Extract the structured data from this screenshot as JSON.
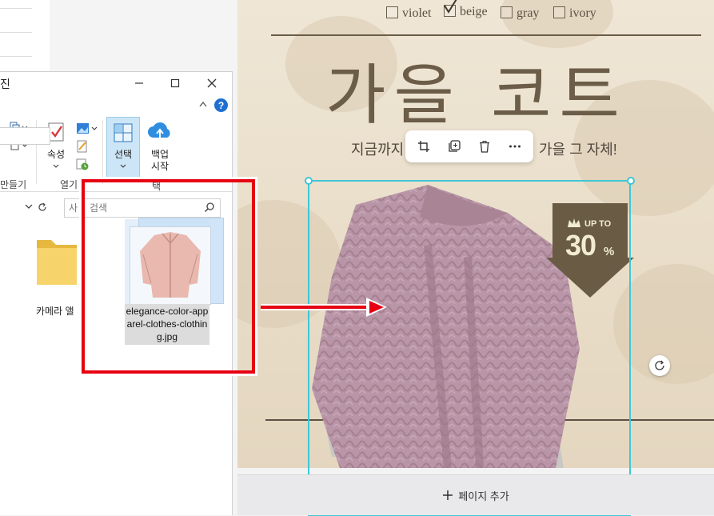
{
  "explorer": {
    "title_fragment": "진",
    "ribbon": {
      "open_group_label": "열기",
      "new_group_fragment": "만들기",
      "select_group_fragment": "택",
      "properties_label": "속성",
      "select_label": "선택",
      "backup_label": "백업",
      "backup_sub": "시작"
    },
    "search_placeholder": "사",
    "search_label": "검색",
    "folder_label": "카메라 앨",
    "help_glyph": "?"
  },
  "drag": {
    "file_name": "elegance-color-apparel-clothes-clothing.jpg"
  },
  "canvas": {
    "colors": [
      {
        "label": "violet",
        "checked": false
      },
      {
        "label": "beige",
        "checked": true
      },
      {
        "label": "gray",
        "checked": false
      },
      {
        "label": "ivory",
        "checked": false
      }
    ],
    "headline": "가을 코트",
    "subline_left": "지금까지",
    "subline_right": "가을 그 자체!",
    "badge_top": "UP TO",
    "badge_value": "30",
    "badge_unit": "%",
    "add_page_label": "페이지 추가"
  },
  "colors": {
    "accent_selection": "#3fc7d6",
    "annotation_red": "#e60012",
    "headline": "#6b5d48",
    "badge": "#6a5b45",
    "badge_text": "#f1ecd0"
  }
}
